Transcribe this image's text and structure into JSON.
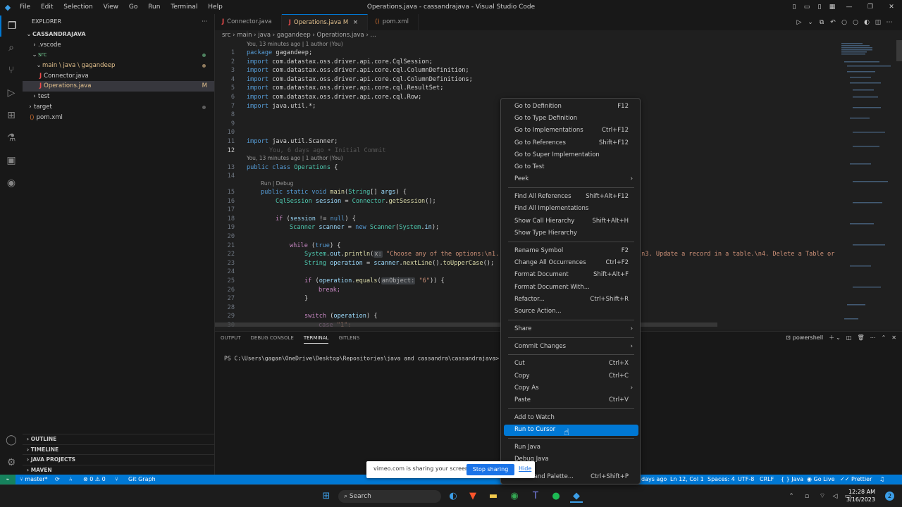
{
  "window": {
    "menu": [
      "File",
      "Edit",
      "Selection",
      "View",
      "Go",
      "Run",
      "Terminal",
      "Help"
    ],
    "title": "Operations.java - cassandrajava - Visual Studio Code"
  },
  "explorer": {
    "header": "EXPLORER",
    "more": "···",
    "root": "CASSANDRAJAVA",
    "items": [
      {
        "label": ".vscode"
      },
      {
        "label": "src"
      },
      {
        "label": "main \\ java \\ gagandeep"
      },
      {
        "label": "Connector.java"
      },
      {
        "label": "Operations.java",
        "mark": "M"
      },
      {
        "label": "test"
      },
      {
        "label": "target"
      },
      {
        "label": "pom.xml"
      }
    ],
    "sections": [
      "OUTLINE",
      "TIMELINE",
      "JAVA PROJECTS",
      "MAVEN"
    ]
  },
  "tabs": [
    {
      "label": "Connector.java"
    },
    {
      "label": "Operations.java",
      "mark": "M",
      "close": "×"
    },
    {
      "label": "pom.xml"
    }
  ],
  "breadcrumb": "src  ›  main  ›  java  ›  gagandeep  ›  Operations.java  ›  ...",
  "editor": {
    "lens1": "You, 13 minutes ago | 1 author (You)",
    "lens2": "You, 13 minutes ago | 1 author (You)",
    "lens3": "Run | Debug",
    "blame": "You, 6 days ago • Initial Commit",
    "lines": {
      "l1a": "package ",
      "l1b": "gagandeep;",
      "l2": "com.datastax.oss.driver.api.core.CqlSession;",
      "l3": "com.datastax.oss.driver.api.core.cql.ColumnDefinition;",
      "l4": "com.datastax.oss.driver.api.core.cql.ColumnDefinitions;",
      "l5": "com.datastax.oss.driver.api.core.cql.ResultSet;",
      "l6": "com.datastax.oss.driver.api.core.cql.Row;",
      "l7": "java.util.*;",
      "l11": "java.util.Scanner;",
      "import": "import ",
      "l13a": "public class ",
      "l13b": "Operations",
      "l13c": " {",
      "l15a": "public static void ",
      "l15b": "main",
      "l15c": "(",
      "l15d": "String",
      "l15e": "[] ",
      "l15f": "args",
      "l15g": ") {",
      "l16a": "CqlSession ",
      "l16b": "session",
      "l16c": " = ",
      "l16d": "Connector",
      "l16e": ".",
      "l16f": "getSession",
      "l16g": "();",
      "l18a": "if ",
      "l18b": "(",
      "l18c": "session",
      "l18d": " != ",
      "l18e": "null",
      "l18f": ") {",
      "l19a": "Scanner ",
      "l19b": "scanner",
      "l19c": " = ",
      "l19d": "new ",
      "l19e": "Scanner",
      "l19f": "(",
      "l19g": "System",
      "l19h": ".",
      "l19i": "in",
      "l19j": ");",
      "l21a": "while ",
      "l21b": "(",
      "l21c": "true",
      "l21d": ") {",
      "l22a": "System",
      "l22b": ".",
      "l22c": "out",
      "l22d": ".",
      "l22e": "println",
      "l22f": "(",
      "l22g": "x:",
      "l22h": " \"Choose any of the options:\\n1. ",
      "l22tail": "\\n3. Update a record in a table.\\n4. Delete a Table or",
      "l23a": "String ",
      "l23b": "operation",
      "l23c": " = ",
      "l23d": "scanner",
      "l23e": ".",
      "l23f": "nextLine",
      "l23g": "().",
      "l23h": "toUpperCase",
      "l23i": "();",
      "l25a": "if ",
      "l25b": "(",
      "l25c": "operation",
      "l25d": ".",
      "l25e": "equals",
      "l25f": "(",
      "l25g": "anObject:",
      "l25h": " \"6\"",
      "l25i": ")) {",
      "l26": "break;",
      "l27": "}",
      "l29a": "switch ",
      "l29b": "(",
      "l29c": "operation",
      "l29d": ") {",
      "l30a": "case ",
      "l30b": "\"1\":"
    }
  },
  "panel": {
    "tabs": [
      "OUTPUT",
      "DEBUG CONSOLE",
      "TERMINAL",
      "GITLENS"
    ],
    "shell": "powershell",
    "prompt": "PS C:\\Users\\gagan\\OneDrive\\Desktop\\Repositories\\java and cassandra\\cassandrajava> "
  },
  "context_menu": {
    "items": [
      {
        "label": "Go to Definition",
        "key": "F12"
      },
      {
        "label": "Go to Type Definition",
        "key": ""
      },
      {
        "label": "Go to Implementations",
        "key": "Ctrl+F12"
      },
      {
        "label": "Go to References",
        "key": "Shift+F12"
      },
      {
        "label": "Go to Super Implementation",
        "key": ""
      },
      {
        "label": "Go to Test",
        "key": ""
      },
      {
        "label": "Peek",
        "key": ""
      },
      {
        "label": "Find All References",
        "key": "Shift+Alt+F12"
      },
      {
        "label": "Find All Implementations",
        "key": ""
      },
      {
        "label": "Show Call Hierarchy",
        "key": "Shift+Alt+H"
      },
      {
        "label": "Show Type Hierarchy",
        "key": ""
      },
      {
        "label": "Rename Symbol",
        "key": "F2"
      },
      {
        "label": "Change All Occurrences",
        "key": "Ctrl+F2"
      },
      {
        "label": "Format Document",
        "key": "Shift+Alt+F"
      },
      {
        "label": "Format Document With...",
        "key": ""
      },
      {
        "label": "Refactor...",
        "key": "Ctrl+Shift+R"
      },
      {
        "label": "Source Action...",
        "key": ""
      },
      {
        "label": "Share",
        "key": ""
      },
      {
        "label": "Commit Changes",
        "key": ""
      },
      {
        "label": "Cut",
        "key": "Ctrl+X"
      },
      {
        "label": "Copy",
        "key": "Ctrl+C"
      },
      {
        "label": "Copy As",
        "key": ""
      },
      {
        "label": "Paste",
        "key": "Ctrl+V"
      },
      {
        "label": "Add to Watch",
        "key": ""
      },
      {
        "label": "Run to Cursor",
        "key": ""
      },
      {
        "label": "Run Java",
        "key": ""
      },
      {
        "label": "Debug Java",
        "key": ""
      },
      {
        "label": "Command Palette...",
        "key": "Ctrl+Shift+P"
      }
    ]
  },
  "share_bar": {
    "text": "vimeo.com is sharing your screen.",
    "stop": "Stop sharing",
    "hide": "Hide"
  },
  "status": {
    "branch": "master*",
    "errors": "⊗ 0 ⚠ 0",
    "gitgraph": "Git Graph",
    "ago": "days ago",
    "position": "Ln 12, Col 1",
    "spaces": "Spaces: 4",
    "encoding": "UTF-8",
    "eol": "CRLF",
    "lang": "{ } Java",
    "golive": "Go Live",
    "prettier": "Prettier"
  },
  "taskbar": {
    "search": "Search",
    "time": "12:28 AM",
    "date": "3/16/2023",
    "badge": "2"
  },
  "colors": {
    "accent": "#0078d4",
    "remote": "#16825d"
  }
}
